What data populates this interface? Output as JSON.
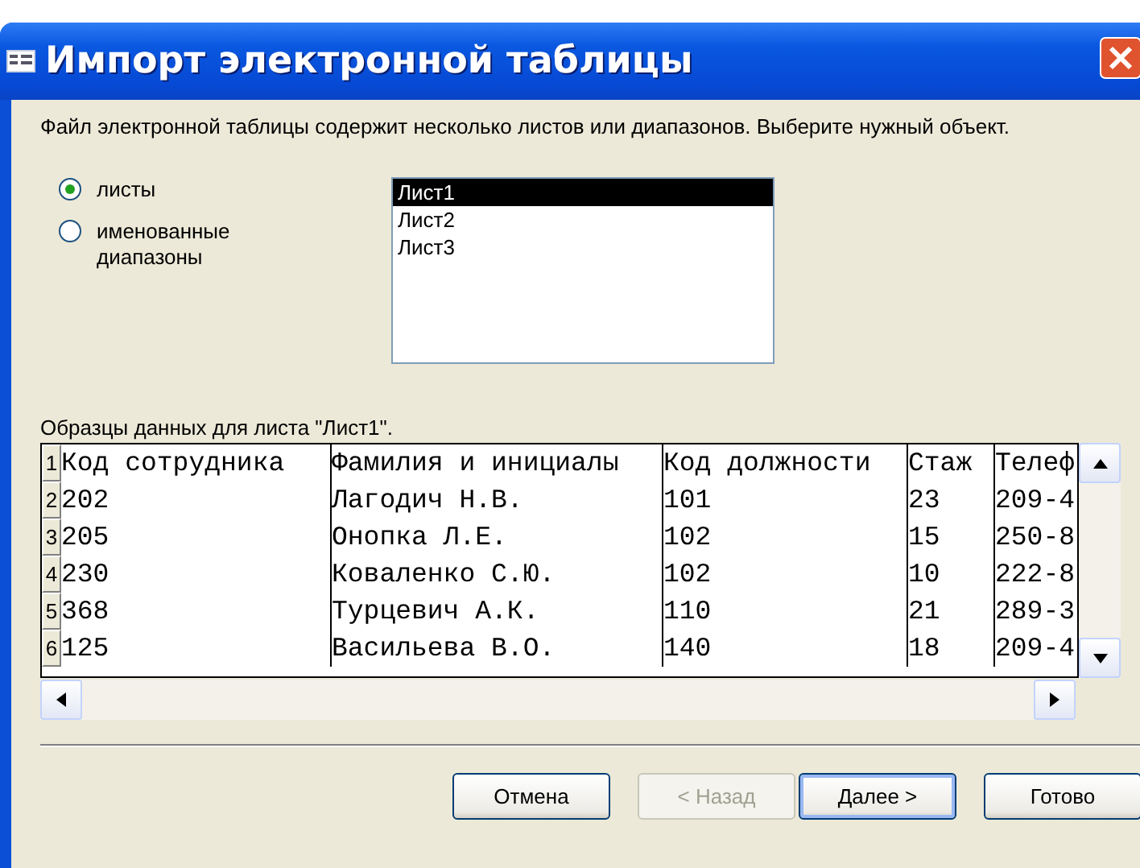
{
  "window": {
    "title": "Импорт электронной таблицы"
  },
  "intro": "Файл электронной таблицы содержит несколько листов или диапазонов.  Выберите нужный объект.",
  "options": [
    {
      "label": "листы",
      "selected": true
    },
    {
      "label": "именованные диапазоны",
      "selected": false
    }
  ],
  "sheets": [
    {
      "label": "Лист1",
      "selected": true
    },
    {
      "label": "Лист2",
      "selected": false
    },
    {
      "label": "Лист3",
      "selected": false
    }
  ],
  "preview": {
    "caption": "Образцы данных для листа \"Лист1\".",
    "rows": [
      {
        "number": "1",
        "cells": [
          "Код сотрудника",
          "Фамилия и инициалы",
          "Код должности",
          "Стаж",
          "Телеф"
        ]
      },
      {
        "number": "2",
        "cells": [
          "202",
          "Лагодич Н.В.",
          "101",
          "23",
          "209-4"
        ]
      },
      {
        "number": "3",
        "cells": [
          "205",
          "Онопка Л.Е.",
          "102",
          "15",
          "250-8"
        ]
      },
      {
        "number": "4",
        "cells": [
          "230",
          "Коваленко С.Ю.",
          "102",
          "10",
          "222-8"
        ]
      },
      {
        "number": "5",
        "cells": [
          "368",
          "Турцевич А.К.",
          "110",
          "21",
          "289-3"
        ]
      },
      {
        "number": "6",
        "cells": [
          "125",
          "Васильева В.О.",
          "140",
          "18",
          "209-4"
        ]
      }
    ]
  },
  "buttons": [
    {
      "label": "Отмена",
      "disabled": false,
      "default": false
    },
    {
      "label": "< Назад",
      "disabled": true,
      "default": false
    },
    {
      "label": "Далее >",
      "disabled": false,
      "default": true
    },
    {
      "label": "Готово",
      "disabled": false,
      "default": false
    }
  ]
}
